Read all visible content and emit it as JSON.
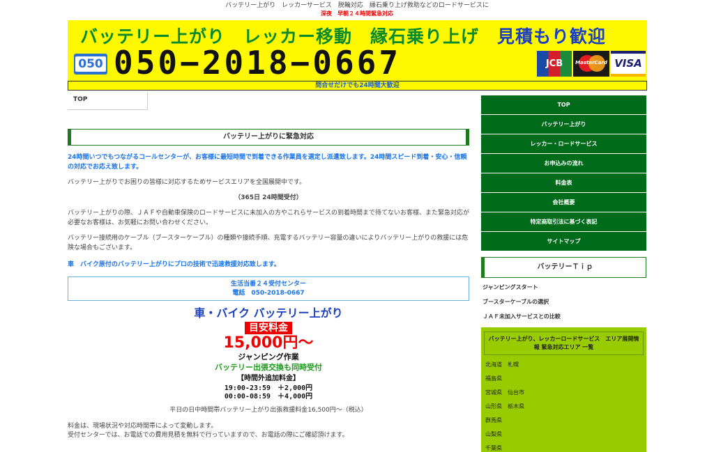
{
  "header": {
    "tagline": "バッテリー上がり　レッカーサービス　脱輪対応　縁石乗り上げ救助などのロードサービスに",
    "tagline2": "深夜　早朝２４時間緊急対応"
  },
  "banner": {
    "line1_green": "バッテリー上がり　レッカー移動　縁石乗り上げ",
    "line1_blue": "見積もり歓迎",
    "logo_050": "050",
    "phone": "050−2018−0667",
    "cards": [
      "JCB",
      "MasterCard",
      "VISA"
    ],
    "strip": "問合せだけでも24時間大歓迎"
  },
  "nav": {
    "top_label": "TOP"
  },
  "main": {
    "heading": "バッテリー上がりに緊急対応",
    "p1": "24時間いつでもつながるコールセンターが、お客様に最短時間で到着できる作業員を選定し派遣致します。24時間スピード到着・安心・信頼の対応でお応え致します。",
    "p2": "バッテリー上がりでお困りの皆様に対応するためサービスエリアを全国展開中です。",
    "p3": "（365日 24時間受付）",
    "p4": "バッテリー上がりの際、ＪＡＦや自動車保険のロードサービスに未加入の方やこれらサービスの到着時間まで待てないお客様、また緊急対応が必要なお客様は、お気軽にお問い合わせください。",
    "p5": "バッテリー接続用のケーブル（ブースターケーブル）の種類や接続手順、充電するバッテリー容量の違いによりバッテリー上がりの救援には危険な場合もございます。",
    "p6": "車　バイク原付のバッテリー上がりにプロの技術で迅速救援対応致します。",
    "box_line1": "生活当番２４受付センター",
    "box_line2": "電話　050-2018-0667",
    "promo": {
      "l1": "車・バイク バッテリー上がり",
      "l2": "目安料金",
      "l3": "15,000円～",
      "l4": "ジャンピング作業",
      "l5": "バッテリー出張交換も同時受付",
      "l6": "【時間外追加料金】",
      "l7a": "19:00-23:59　＋2,000円",
      "l7b": "00:00-08:59　＋4,000円"
    },
    "p7": "平日の日中時間帯バッテリー上がり出張救援料金16,500円～（税込）",
    "p8": "料金は、現場状況や対応時間帯によって変動します。",
    "p9": "受付センターでは、お電話での費用見積を無料で行っていますので、お電話の際にご確認頂けます。"
  },
  "sidebar": {
    "menu": [
      "TOP",
      "バッテリー上がり",
      "レッカー・ロードサービス",
      "お申込みの流れ",
      "料金表",
      "会社概要",
      "特定商取引法に基づく表記",
      "サイトマップ"
    ],
    "tip_heading": "バッテリーＴｉｐ",
    "tips": [
      "ジャンピングスタート",
      "ブースターケーブルの選択",
      "ＪＡＦ未加入サービスとの比較"
    ],
    "area_heading": "バッテリー上がり、レッカーロードサービス　エリア展開情報 緊急対応エリア 一覧",
    "areas": [
      "北海道　札幌",
      "福島県",
      "宮城県　仙台市",
      "山形県　栃木県",
      "群馬県",
      "山梨県",
      "千葉県"
    ]
  },
  "colors": {
    "green": "#006b1a",
    "yellow": "#fff900",
    "blue": "#1a73e8",
    "red": "#e00",
    "lime": "#99cc00"
  }
}
